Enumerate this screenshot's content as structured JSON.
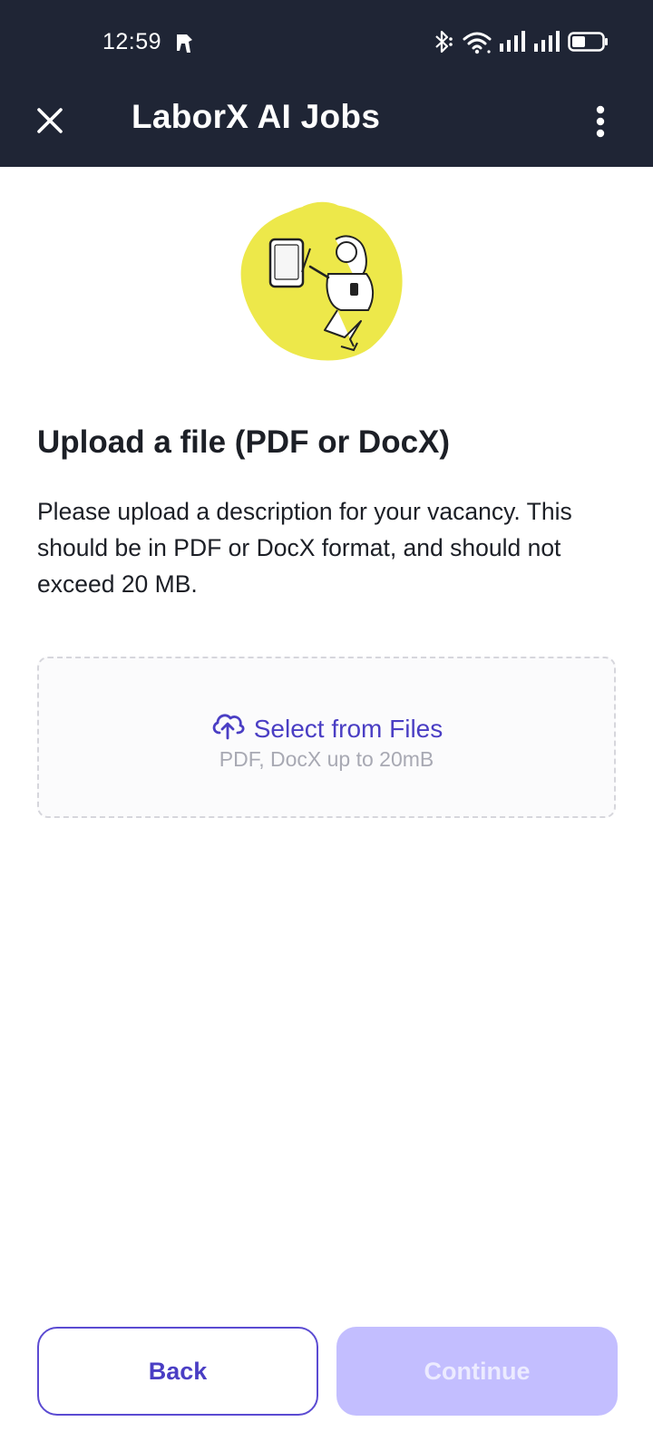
{
  "status_bar": {
    "time": "12:59"
  },
  "app_bar": {
    "title": "LaborX AI Jobs"
  },
  "content": {
    "heading": "Upload a file (PDF or DocX)",
    "description": "Please upload a description for your vacancy. This should be in PDF or DocX format, and should not exceed 20 MB."
  },
  "upload": {
    "label": "Select from Files",
    "hint": "PDF, DocX up to 20mB"
  },
  "footer": {
    "back_label": "Back",
    "continue_label": "Continue"
  },
  "colors": {
    "header_bg": "#1f2535",
    "accent": "#4a3ec4",
    "continue_disabled_bg": "#c3beff",
    "illustration_yellow": "#ede84a"
  },
  "icons": {
    "close": "close-icon",
    "menu": "more-vertical-icon",
    "upload": "cloud-upload-icon"
  }
}
